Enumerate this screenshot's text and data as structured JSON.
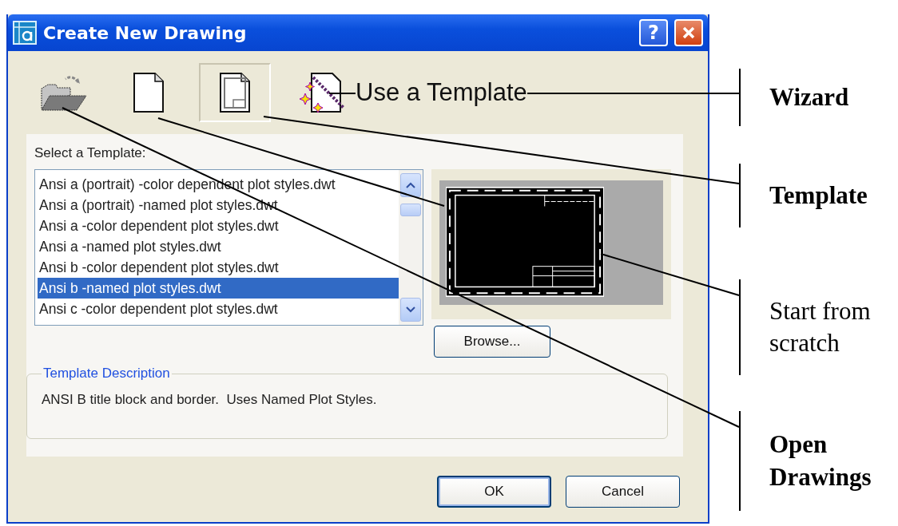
{
  "window": {
    "title": "Create New Drawing"
  },
  "title_buttons": [
    {
      "kind": "help",
      "label": "?"
    },
    {
      "kind": "close"
    }
  ],
  "tabs": [
    {
      "kind": "open",
      "selected": false
    },
    {
      "kind": "scratch",
      "selected": false
    },
    {
      "kind": "template",
      "selected": true
    },
    {
      "kind": "wizard",
      "selected": false
    }
  ],
  "heading": "Use a Template",
  "list_label": "Select a Template:",
  "templates": [
    {
      "label": "Ansi a (portrait) -color dependent plot styles.dwt",
      "selected": false
    },
    {
      "label": "Ansi a (portrait) -named plot styles.dwt",
      "selected": false
    },
    {
      "label": "Ansi a -color dependent plot styles.dwt",
      "selected": false
    },
    {
      "label": "Ansi a -named plot styles.dwt",
      "selected": false
    },
    {
      "label": "Ansi b -color dependent plot styles.dwt",
      "selected": false
    },
    {
      "label": "Ansi b -named plot styles.dwt",
      "selected": true
    },
    {
      "label": "Ansi c -color dependent plot styles.dwt",
      "selected": false
    }
  ],
  "browse_button": "Browse...",
  "description": {
    "legend": "Template Description",
    "text": "ANSI B title block and border.  Uses Named Plot Styles."
  },
  "buttons": [
    "OK",
    "Cancel"
  ],
  "annotations": [
    {
      "kind": "wizard",
      "label": "Wizard"
    },
    {
      "kind": "template",
      "label": "Template"
    },
    {
      "kind": "scratch",
      "label": "Start from scratch"
    },
    {
      "kind": "open",
      "label": "Open Drawings"
    }
  ]
}
